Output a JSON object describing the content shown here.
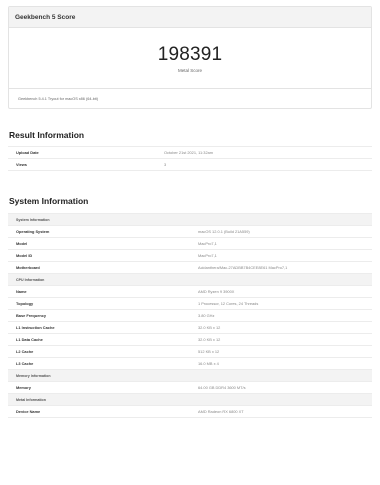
{
  "score_card": {
    "title": "Geekbench 5 Score",
    "score": "198391",
    "score_label": "Metal Score",
    "footer": "Geekbench 5.4.1 Tryout for macOS x86 (64-bit)"
  },
  "result_info": {
    "title": "Result Information",
    "rows": [
      {
        "label": "Upload Date",
        "value": "October 21st 2021, 11:32am"
      },
      {
        "label": "Views",
        "value": "3"
      }
    ]
  },
  "system_info": {
    "title": "System Information",
    "system_header": "System Information",
    "system_rows": [
      {
        "label": "Operating System",
        "value": "macOS 12.0.1 (Build 21A559)"
      },
      {
        "label": "Model",
        "value": "MacPro7,1"
      },
      {
        "label": "Model ID",
        "value": "MacPro7,1"
      },
      {
        "label": "Motherboard",
        "value": "Acidanthera/Mac-27ADBB7B4CEE8E61 MacPro7,1"
      }
    ],
    "cpu_header": "CPU Information",
    "cpu_rows": [
      {
        "label": "Name",
        "value": "AMD Ryzen 9 3900X"
      },
      {
        "label": "Topology",
        "value": "1 Processor, 12 Cores, 24 Threads"
      },
      {
        "label": "Base Frequency",
        "value": "3.80 GHz"
      },
      {
        "label": "L1 Instruction Cache",
        "value": "32.0 KB x 12"
      },
      {
        "label": "L1 Data Cache",
        "value": "32.0 KB x 12"
      },
      {
        "label": "L2 Cache",
        "value": "512 KB x 12"
      },
      {
        "label": "L3 Cache",
        "value": "16.0 MB x 4"
      }
    ],
    "memory_header": "Memory Information",
    "memory_rows": [
      {
        "label": "Memory",
        "value": "64.00 GB DDR4 3600 MT/s"
      }
    ],
    "metal_header": "Metal Information",
    "metal_rows": [
      {
        "label": "Device Name",
        "value": "AMD Radeon RX 6800 XT"
      }
    ]
  }
}
